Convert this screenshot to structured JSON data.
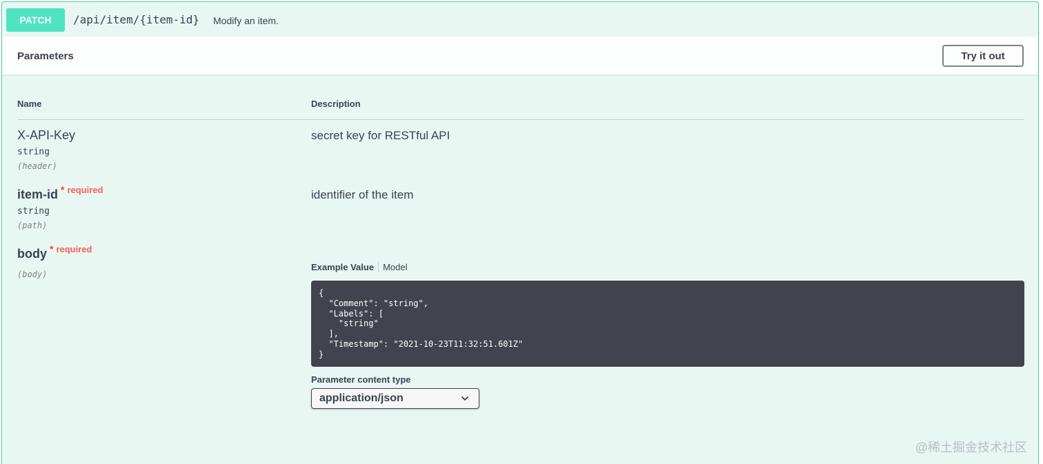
{
  "operation": {
    "method": "PATCH",
    "path": "/api/item/{item-id}",
    "summary": "Modify an item.",
    "accent_color": "#49cc90",
    "method_color": "#50e3c2"
  },
  "parameters": {
    "title": "Parameters",
    "try_label": "Try it out",
    "columns": {
      "name": "Name",
      "description": "Description"
    },
    "items": [
      {
        "name": "X-API-Key",
        "required": "",
        "type": "string",
        "in": "(header)",
        "description": "secret key for RESTful API"
      },
      {
        "name": "item-id",
        "required_star": "*",
        "required": "required",
        "type": "string",
        "in": "(path)",
        "description": "identifier of the item"
      },
      {
        "name": "body",
        "required_star": "*",
        "required": "required",
        "in": "(body)"
      }
    ]
  },
  "body": {
    "tab_example": "Example Value",
    "tab_model": "Model",
    "example": "{\n  \"Comment\": \"string\",\n  \"Labels\": [\n    \"string\"\n  ],\n  \"Timestamp\": \"2021-10-23T11:32:51.601Z\"\n}",
    "content_type_label": "Parameter content type",
    "content_type_value": "application/json",
    "chevron_icon": "chevron-down-icon"
  },
  "watermark": "@稀土掘金技术社区"
}
